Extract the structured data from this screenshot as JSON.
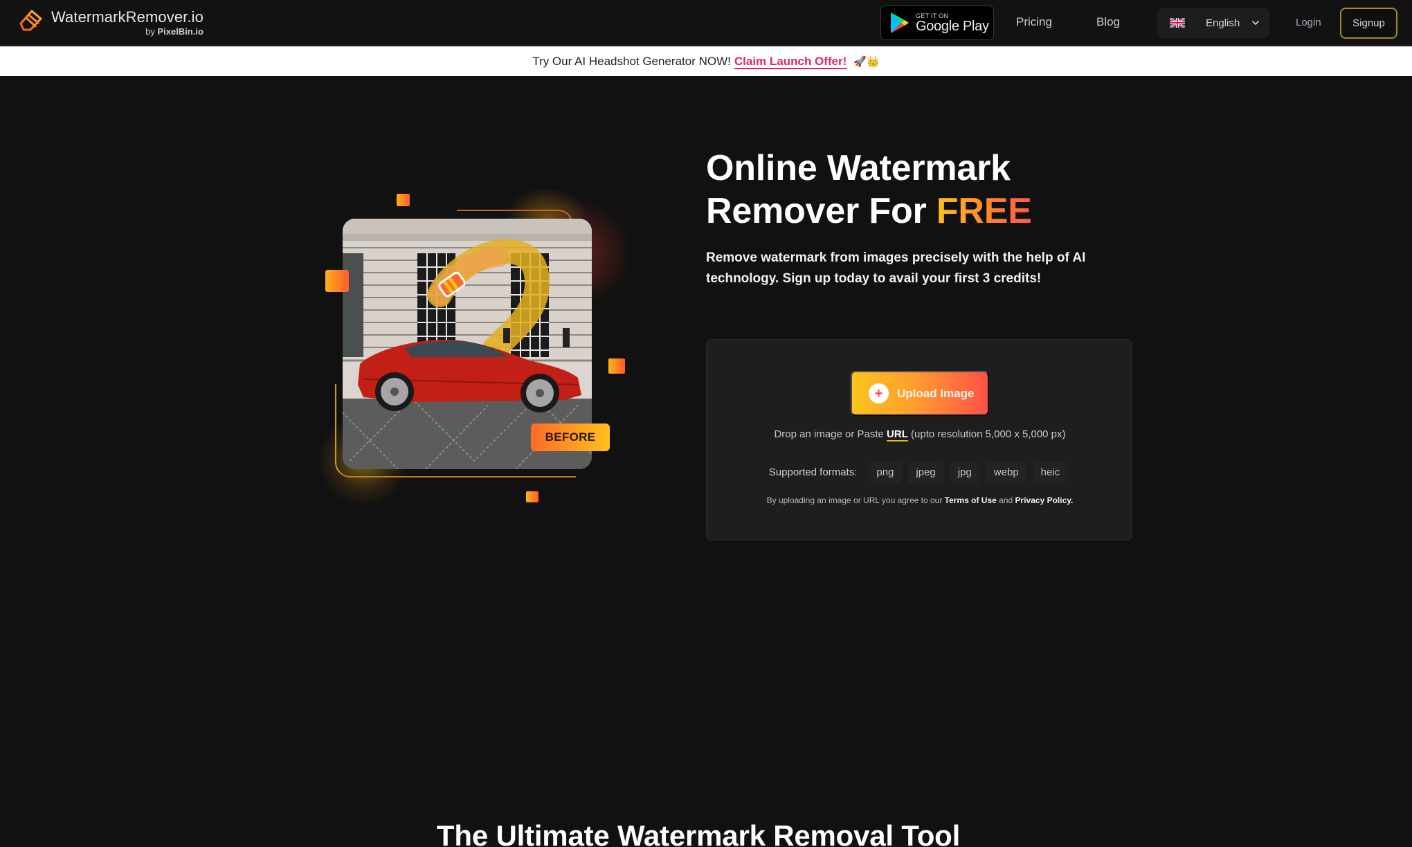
{
  "navbar": {
    "logo": {
      "name": "WatermarkRemover.io",
      "by_prefix": "by",
      "by_brand": "PixelBin.io",
      "icon": "eraser-logo-icon"
    },
    "google_play": {
      "small": "GET IT ON",
      "big": "Google Play",
      "icon": "google-play-icon"
    },
    "links": [
      {
        "label": "Pricing"
      },
      {
        "label": "Blog"
      }
    ],
    "language": {
      "label": "English",
      "flag": "uk-flag-icon",
      "chevron": "chevron-down-icon"
    },
    "login_label": "Login",
    "signup_label": "Signup"
  },
  "banner": {
    "text": "Try Our AI Headshot Generator NOW!",
    "link_label": "Claim Launch Offer!",
    "emoji": "🚀👑"
  },
  "hero": {
    "title_line1": "Online Watermark",
    "title_line2_prefix": "Remover For",
    "title_highlight": "FREE",
    "subtitle": "Remove watermark from images precisely with the help of AI technology. Sign up today to avail your first 3 credits!",
    "illustration": {
      "badge": "BEFORE",
      "description": "red sports car parked in front of a building with watermark"
    }
  },
  "upload": {
    "button_label": "Upload Image",
    "button_icon": "plus-icon",
    "drop_prefix": "Drop an image or Paste",
    "drop_link": "URL",
    "drop_suffix": "(upto resolution 5,000 x 5,000 px)",
    "formats_label": "Supported formats:",
    "formats": [
      "png",
      "jpeg",
      "jpg",
      "webp",
      "heic"
    ],
    "legal_prefix": "By uploading an image or URL you agree to our",
    "terms_label": "Terms of Use",
    "legal_and": "and",
    "privacy_label": "Privacy Policy."
  },
  "section": {
    "title": "The Ultimate Watermark Removal Tool"
  },
  "colors": {
    "background": "#111111",
    "accent_yellow": "#fbc51d",
    "accent_red": "#ff5147",
    "banner_link": "#e0266c",
    "signup_border": "#a68a2c"
  }
}
